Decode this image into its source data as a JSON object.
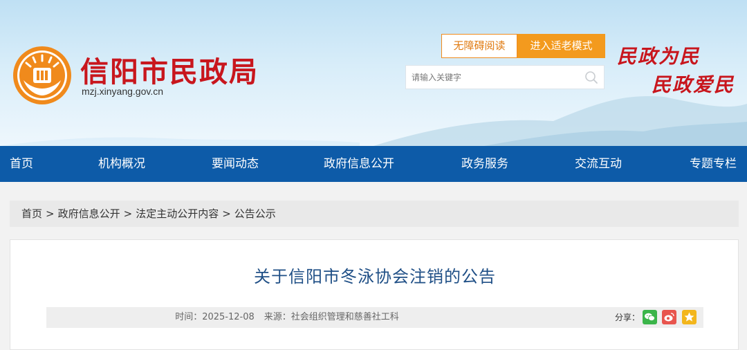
{
  "header": {
    "site_name": "信阳市民政局",
    "site_url": "mzj.xinyang.gov.cn",
    "accessible_label": "无障碍阅读",
    "elder_mode_label": "进入适老模式",
    "search_placeholder": "请输入关键字",
    "slogan_line1": "民政为民",
    "slogan_line2": "民政爱民",
    "brand_color": "#c8161d",
    "accent_color": "#f39a1e"
  },
  "nav": {
    "color": "#0d5ba8",
    "items": [
      {
        "label": "首页"
      },
      {
        "label": "机构概况"
      },
      {
        "label": "要闻动态"
      },
      {
        "label": "政府信息公开"
      },
      {
        "label": "政务服务"
      },
      {
        "label": "交流互动"
      },
      {
        "label": "专题专栏"
      }
    ]
  },
  "breadcrumb": {
    "items": [
      "首页",
      "政府信息公开",
      "法定主动公开内容",
      "公告公示"
    ],
    "separator": ">"
  },
  "article": {
    "title": "关于信阳市冬泳协会注销的公告",
    "time_label": "时间：",
    "time": "2025-12-08",
    "source_label": "来源：",
    "source": "社会组织管理和慈善社工科",
    "share_label": "分享：",
    "share_icons": [
      "wechat-icon",
      "weibo-icon",
      "qzone-icon"
    ]
  }
}
